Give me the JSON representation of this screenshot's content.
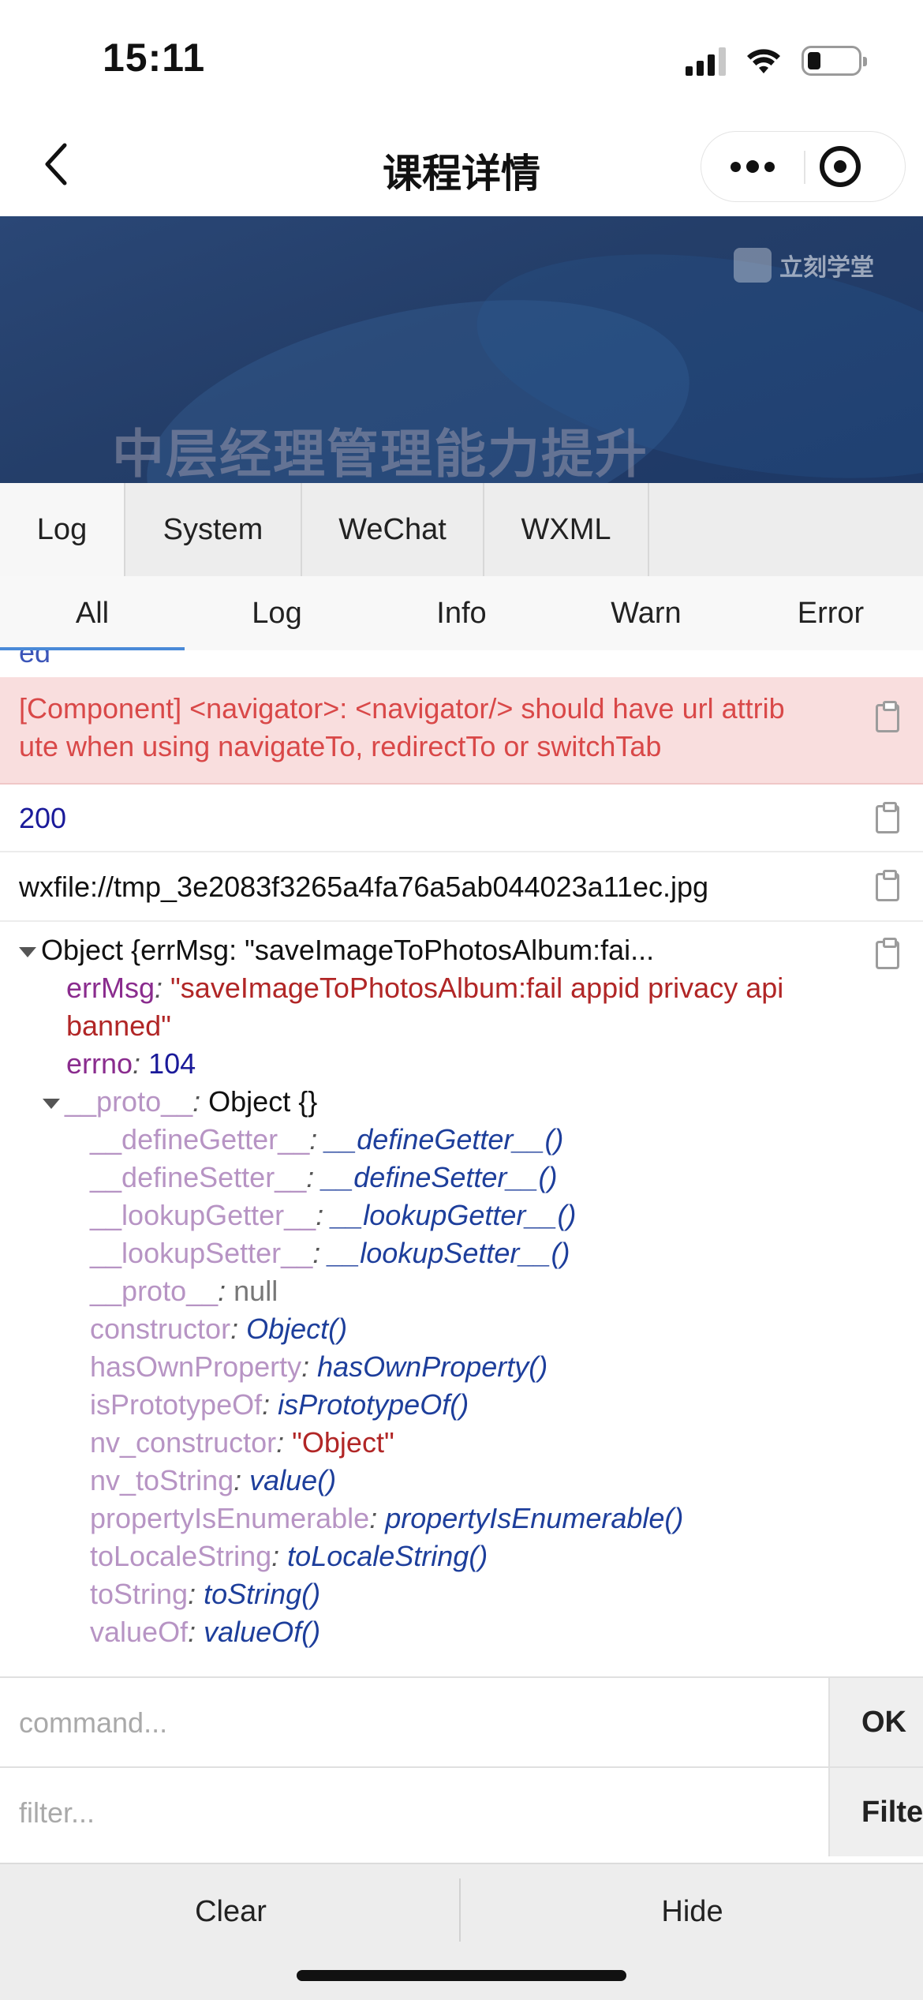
{
  "status": {
    "time": "15:11"
  },
  "nav": {
    "title": "课程详情"
  },
  "banner": {
    "logo_text": "立刻学堂",
    "title": "中层经理管理能力提升"
  },
  "console": {
    "tabs": [
      "Log",
      "System",
      "WeChat",
      "WXML"
    ],
    "subtabs": [
      "All",
      "Log",
      "Info",
      "Warn",
      "Error"
    ],
    "active_subtab": "All"
  },
  "logs": {
    "cut_text": "ed",
    "error_msg": "[Component] <navigator>: <navigator/> should have url attribute when using navigateTo, redirectTo or switchTab",
    "error_line1": "[Component] <navigator>: <navigator/> should have url attrib",
    "error_line2": "ute when using navigateTo, redirectTo or switchTab",
    "status_code": "200",
    "file_path": "wxfile://tmp_3e2083f3265a4fa76a5ab044023a11ec.jpg",
    "object": {
      "summary": "Object {errMsg: \"saveImageToPhotosAlbum:fai...",
      "errMsg_key": "errMsg",
      "errMsg_val_line1": "\"saveImageToPhotosAlbum:fail appid privacy api",
      "errMsg_val_line2": "banned\"",
      "errno_key": "errno",
      "errno_val": "104",
      "proto_key": "__proto__",
      "proto_val": "Object {}",
      "members": [
        {
          "key": "__defineGetter__",
          "value": "__defineGetter__()",
          "type": "fn"
        },
        {
          "key": "__defineSetter__",
          "value": "__defineSetter__()",
          "type": "fn"
        },
        {
          "key": "__lookupGetter__",
          "value": "__lookupGetter__()",
          "type": "fn"
        },
        {
          "key": "__lookupSetter__",
          "value": "__lookupSetter__()",
          "type": "fn"
        },
        {
          "key": "__proto__",
          "value": "null",
          "type": "null"
        },
        {
          "key": "constructor",
          "value": "Object()",
          "type": "fn"
        },
        {
          "key": "hasOwnProperty",
          "value": "hasOwnProperty()",
          "type": "fn"
        },
        {
          "key": "isPrototypeOf",
          "value": "isPrototypeOf()",
          "type": "fn"
        },
        {
          "key": "nv_constructor",
          "value": "\"Object\"",
          "type": "str"
        },
        {
          "key": "nv_toString",
          "value": "value()",
          "type": "fn"
        },
        {
          "key": "propertyIsEnumerable",
          "value": "propertyIsEnumerable()",
          "type": "fn"
        },
        {
          "key": "toLocaleString",
          "value": "toLocaleString()",
          "type": "fn"
        },
        {
          "key": "toString",
          "value": "toString()",
          "type": "fn"
        },
        {
          "key": "valueOf",
          "value": "valueOf()",
          "type": "fn"
        }
      ]
    }
  },
  "command": {
    "placeholder": "command...",
    "ok_label": "OK"
  },
  "filter": {
    "placeholder": "filter...",
    "filter_label": "Filter"
  },
  "bottom": {
    "clear_label": "Clear",
    "hide_label": "Hide"
  }
}
